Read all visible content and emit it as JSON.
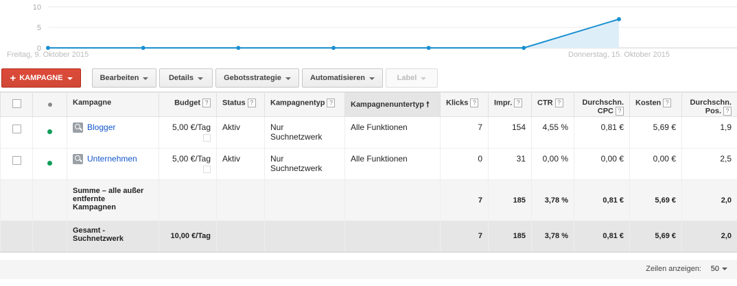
{
  "chart": {
    "y_ticks": [
      "10",
      "5",
      "0"
    ],
    "start_label": "Freitag, 9. Oktober 2015",
    "end_label": "Donnerstag, 15. Oktober 2015",
    "line_color": "#1a8fd1",
    "fill_color": "#deeef9"
  },
  "chart_data": {
    "type": "area",
    "x": [
      "2015-10-09",
      "2015-10-10",
      "2015-10-11",
      "2015-10-12",
      "2015-10-13",
      "2015-10-14",
      "2015-10-15"
    ],
    "values": [
      0,
      0,
      0,
      0,
      0,
      0,
      7
    ],
    "ylim": [
      0,
      10
    ],
    "grid": true
  },
  "toolbar": {
    "campaign_label": "KAMPAGNE",
    "edit_label": "Bearbeiten",
    "details_label": "Details",
    "bid_label": "Gebotsstrategie",
    "automate_label": "Automatisieren",
    "label_label": "Label",
    "accent": "#d14836"
  },
  "table": {
    "headers": {
      "campaign": "Kampagne",
      "budget": "Budget",
      "status": "Status",
      "type": "Kampagnentyp",
      "subtype": "Kampagnenuntertyp",
      "clicks": "Klicks",
      "impr": "Impr.",
      "ctr": "CTR",
      "cpc1": "Durchschn.",
      "cpc2": "CPC",
      "cost": "Kosten",
      "pos1": "Durchschn.",
      "pos2": "Pos."
    },
    "help_glyph": "?",
    "sort_arrow": "🠕",
    "rows": [
      {
        "campaign": "Blogger",
        "budget": "5,00 €/Tag",
        "status": "Aktiv",
        "type1": "Nur",
        "type2": "Suchnetzwerk",
        "subtype": "Alle Funktionen",
        "clicks": "7",
        "impr": "154",
        "ctr": "4,55 %",
        "cpc": "0,81 €",
        "cost": "5,69 €",
        "pos": "1,9"
      },
      {
        "campaign": "Unternehmen",
        "budget": "5,00 €/Tag",
        "status": "Aktiv",
        "type1": "Nur",
        "type2": "Suchnetzwerk",
        "subtype": "Alle Funktionen",
        "clicks": "0",
        "impr": "31",
        "ctr": "0,00 %",
        "cpc": "0,00 €",
        "cost": "0,00 €",
        "pos": "2,5"
      }
    ],
    "summary": {
      "label1": "Summe – alle außer",
      "label2": "entfernte",
      "label3": "Kampagnen",
      "clicks": "7",
      "impr": "185",
      "ctr": "3,78 %",
      "cpc": "0,81 €",
      "cost": "5,69 €",
      "pos": "2,0"
    },
    "total": {
      "label1": "Gesamt -",
      "label2": "Suchnetzwerk",
      "budget": "10,00 €/Tag",
      "clicks": "7",
      "impr": "185",
      "ctr": "3,78 %",
      "cpc": "0,81 €",
      "cost": "5,69 €",
      "pos": "2,0"
    }
  },
  "footer": {
    "rows_label": "Zeilen anzeigen:",
    "rows_value": "50"
  }
}
